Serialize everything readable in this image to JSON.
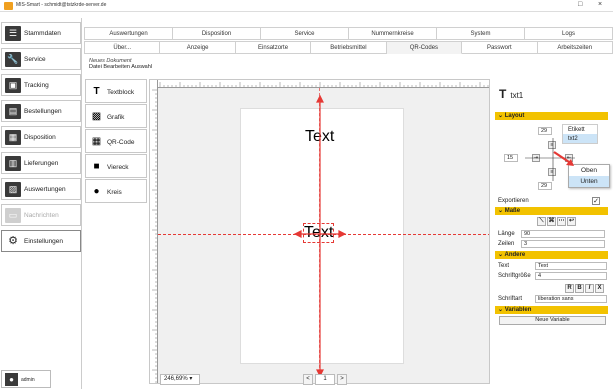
{
  "window": {
    "title": "MIS-Smart - schmidt@tstzkrde-server.de",
    "minimize": "□",
    "close": "×"
  },
  "sidebar": {
    "items": [
      {
        "label": "Stammdaten",
        "icon": "list-icon"
      },
      {
        "label": "Service",
        "icon": "wrench-icon"
      },
      {
        "label": "Tracking",
        "icon": "truck-icon"
      },
      {
        "label": "Bestellungen",
        "icon": "cart-icon"
      },
      {
        "label": "Disposition",
        "icon": "calendar-icon"
      },
      {
        "label": "Lieferungen",
        "icon": "delivery-icon"
      },
      {
        "label": "Auswertungen",
        "icon": "chart-icon"
      },
      {
        "label": "Nachrichten",
        "icon": "message-icon"
      },
      {
        "label": "Einstellungen",
        "icon": "gear-icon"
      }
    ],
    "user": "admin"
  },
  "tabs_row1": [
    "Auswertungen",
    "Disposition",
    "Service",
    "Nummernkreise",
    "System",
    "Logs"
  ],
  "tabs_row2": [
    "Über...",
    "Anzeige",
    "Einsatzorte",
    "Betriebsmittel",
    "QR-Codes",
    "Passwort",
    "Arbeitszeiten"
  ],
  "document": {
    "name": "Neues Dokument",
    "menu": [
      "Datei",
      "Bearbeiten",
      "Auswahl"
    ]
  },
  "tools": [
    {
      "label": "Textblock",
      "icon": "text-tool-icon"
    },
    {
      "label": "Grafik",
      "icon": "image-tool-icon"
    },
    {
      "label": "QR-Code",
      "icon": "qrcode-tool-icon"
    },
    {
      "label": "Viereck",
      "icon": "rectangle-tool-icon"
    },
    {
      "label": "Kreis",
      "icon": "circle-tool-icon"
    }
  ],
  "canvas": {
    "text1": "Text",
    "text2": "Text",
    "zoom": "246,69%",
    "page": "1",
    "prev": "<",
    "next": ">"
  },
  "props": {
    "element_name": "txt1",
    "sections": {
      "layout": "Layout",
      "masse": "Maße",
      "andere": "Andere",
      "variablen": "Variablen"
    },
    "layout": {
      "top_value": "29",
      "left_value": "15",
      "bottom_value": "29",
      "dropdown": [
        "Etikett",
        "txt2"
      ],
      "menu": [
        "Oben",
        "Unten"
      ]
    },
    "exportieren_label": "Exportieren",
    "exportieren_checked": "✓",
    "laenge_label": "Länge",
    "laenge_value": "90",
    "zeilen_label": "Zeilen",
    "zeilen_value": "3",
    "text_label": "Text",
    "text_value": "Text",
    "schriftgroesse_label": "Schriftgröße",
    "schriftgroesse_value": "4",
    "format": [
      "R",
      "B",
      "I",
      "X"
    ],
    "schriftart_label": "Schriftart",
    "schriftart_value": "liberation sans",
    "new_variable": "Neue Variable"
  },
  "colors": {
    "accent_yellow": "#f2c200",
    "guide_red": "#e53935"
  }
}
